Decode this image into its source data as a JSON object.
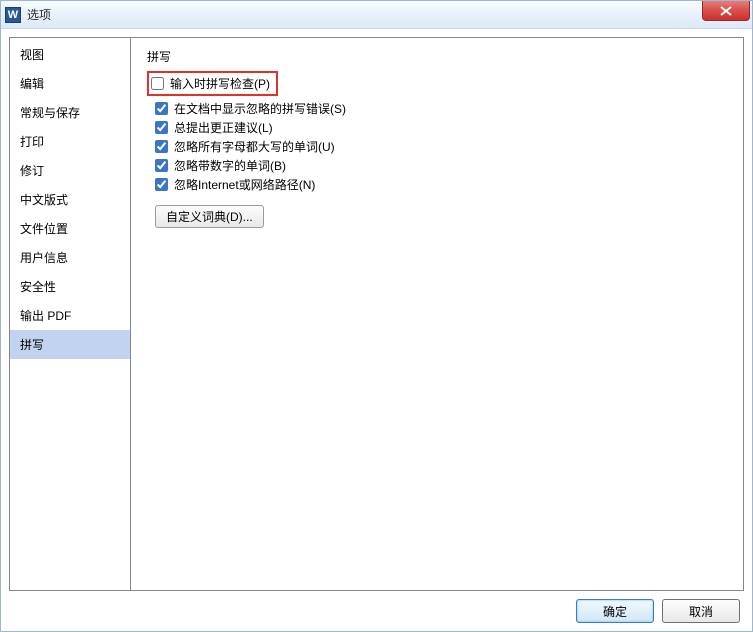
{
  "title": "选项",
  "titlebar_icon_letter": "W",
  "sidebar": {
    "items": [
      {
        "label": "视图"
      },
      {
        "label": "编辑"
      },
      {
        "label": "常规与保存"
      },
      {
        "label": "打印"
      },
      {
        "label": "修订"
      },
      {
        "label": "中文版式"
      },
      {
        "label": "文件位置"
      },
      {
        "label": "用户信息"
      },
      {
        "label": "安全性"
      },
      {
        "label": "输出 PDF"
      },
      {
        "label": "拼写"
      }
    ],
    "selected_index": 10
  },
  "section_title": "拼写",
  "options": [
    {
      "label": "输入时拼写检查(P)",
      "checked": false,
      "highlighted": true
    },
    {
      "label": "在文档中显示忽略的拼写错误(S)",
      "checked": true
    },
    {
      "label": "总提出更正建议(L)",
      "checked": true
    },
    {
      "label": "忽略所有字母都大写的单词(U)",
      "checked": true
    },
    {
      "label": "忽略带数字的单词(B)",
      "checked": true
    },
    {
      "label": "忽略Internet或网络路径(N)",
      "checked": true
    }
  ],
  "custom_dict_button": "自定义词典(D)...",
  "footer": {
    "ok": "确定",
    "cancel": "取消"
  }
}
